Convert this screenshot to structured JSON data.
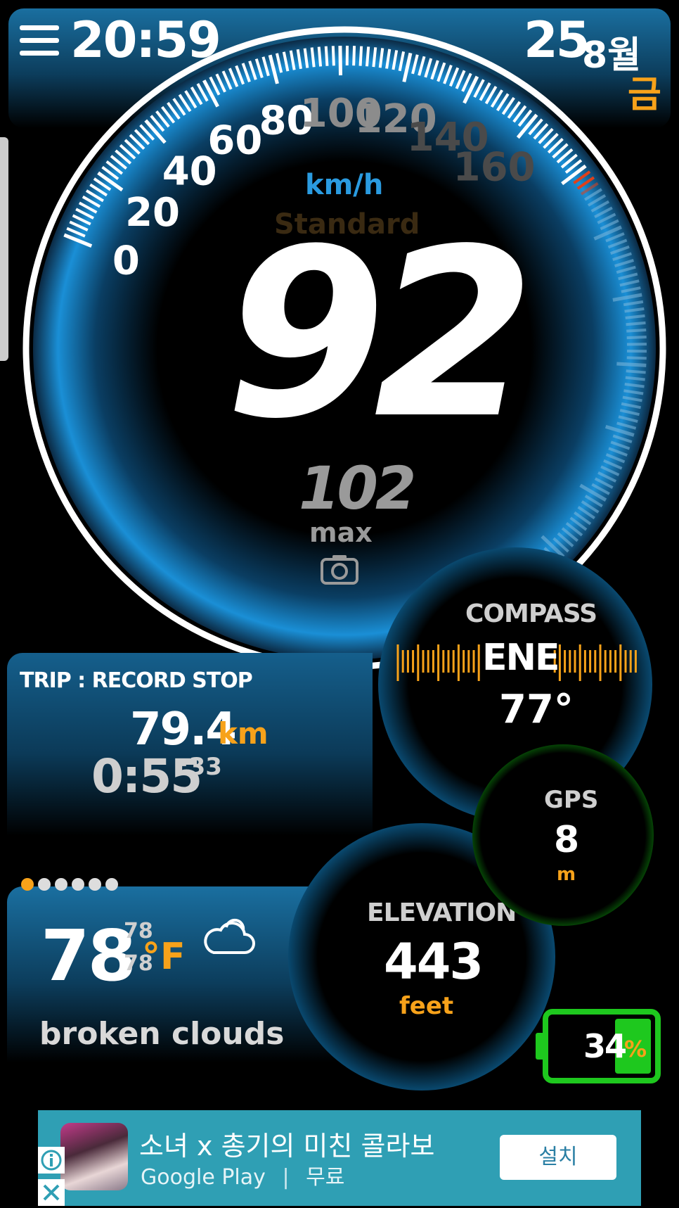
{
  "status": {
    "time": "20:59",
    "day": "25",
    "month": "8월",
    "weekday": "금"
  },
  "speedometer": {
    "unit": "km/h",
    "mode": "Standard",
    "speed": "92",
    "max_value": "102",
    "max_label": "max",
    "scale_labels": [
      "0",
      "20",
      "40",
      "60",
      "80",
      "100",
      "120",
      "140",
      "160"
    ],
    "speed_fraction": 0.575
  },
  "trip": {
    "title": "TRIP : RECORD STOP",
    "distance": "79.4",
    "distance_unit": "km",
    "time": "0:55",
    "seconds": ":33"
  },
  "weather": {
    "page_dots": 6,
    "active_dot": 0,
    "temp": "78",
    "temp_high": "78",
    "temp_low": "78",
    "temp_unit": "°F",
    "description": "broken clouds",
    "icon": "cloud-icon"
  },
  "compass": {
    "label": "COMPASS",
    "direction": "ENE",
    "degrees": "77°"
  },
  "gps": {
    "label": "GPS",
    "accuracy": "8",
    "unit": "m"
  },
  "elevation": {
    "label": "ELEVATION",
    "value": "443",
    "unit": "feet"
  },
  "battery": {
    "level": "34",
    "percent_sign": "%",
    "fraction": 0.34
  },
  "ad": {
    "title": "소녀 x 총기의 미친 콜라보",
    "store": "Google Play",
    "separator": "|",
    "price": "무료",
    "button": "설치"
  },
  "colors": {
    "accent": "#f7a21a",
    "gauge_blue": "#1a8fd6",
    "gps_green": "#28d628",
    "ad_bg": "#2f9fb4"
  }
}
